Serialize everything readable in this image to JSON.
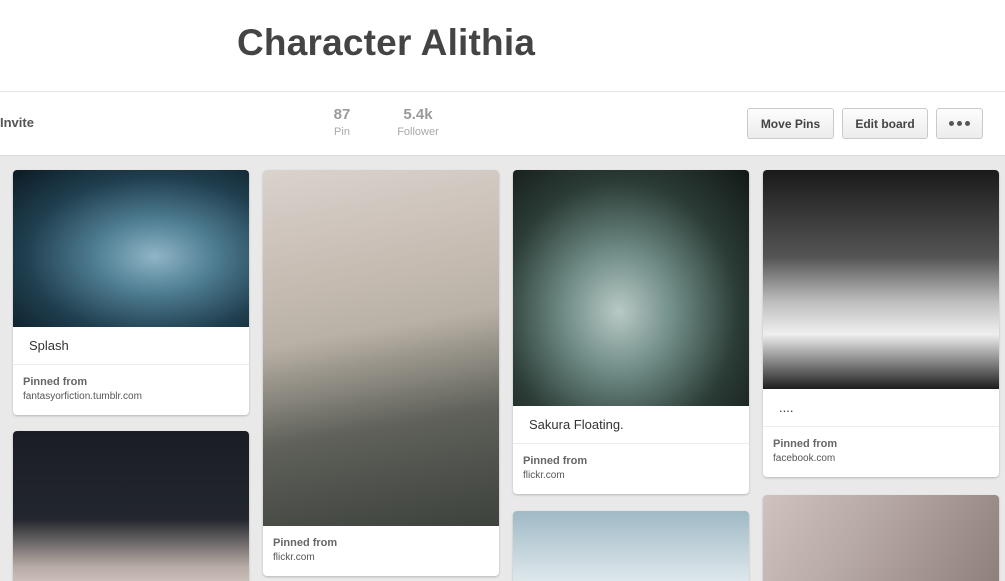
{
  "board": {
    "title": "Character Alithia",
    "invite_label": "Invite",
    "pins_count": "87",
    "pins_label": "Pin",
    "followers_count": "5.4k",
    "followers_label": "Follower"
  },
  "actions": {
    "move_pins": "Move Pins",
    "edit_board": "Edit board",
    "more_icon": "more-dots-icon"
  },
  "pins": [
    {
      "description": "Splash",
      "source_label": "Pinned from",
      "source": "fantasyorfiction.tumblr.com"
    },
    {
      "description": "",
      "source_label": "Pinned from",
      "source": "flickr.com"
    },
    {
      "description": "Sakura Floating.",
      "source_label": "Pinned from",
      "source": "flickr.com"
    },
    {
      "description": "....",
      "source_label": "Pinned from",
      "source": "facebook.com"
    }
  ],
  "colors": {
    "header_bg": "#ffffff",
    "page_bg": "#e9e9e9",
    "title": "#444444"
  }
}
